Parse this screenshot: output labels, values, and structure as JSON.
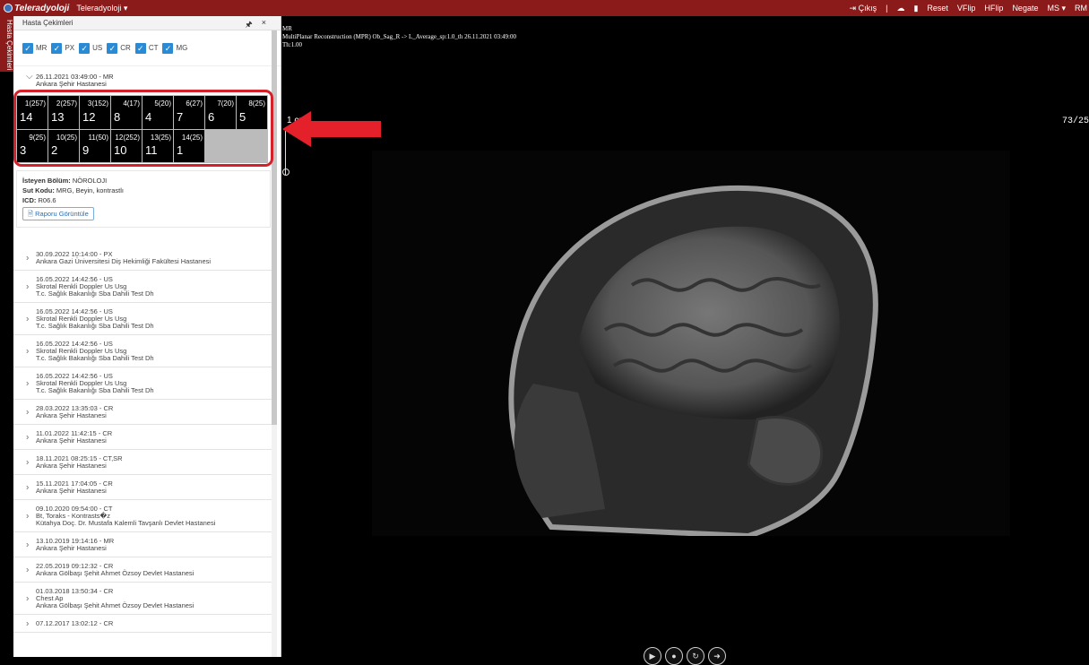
{
  "topbar": {
    "logo": "Teleradyoloji",
    "app_menu": "Teleradyoloji ▾",
    "logout": "Çıkış",
    "reset": "Reset",
    "vflip": "VFlip",
    "hflip": "HFlip",
    "negate": "Negate",
    "ms": "MS ▾",
    "rm": "RM"
  },
  "side_tab": "Hasta Çekimleri",
  "panel": {
    "title": "Hasta Çekimleri",
    "pin": "🖈",
    "close": "×",
    "filters": [
      "MR",
      "PX",
      "US",
      "CR",
      "CT",
      "MG"
    ]
  },
  "open_study": {
    "line1": "26.11.2021 03:49:00 - MR",
    "line2": "Ankara Şehir Hastanesi"
  },
  "series": [
    {
      "num": "14",
      "sup": "1(257)"
    },
    {
      "num": "13",
      "sup": "2(257)"
    },
    {
      "num": "12",
      "sup": "3(152)"
    },
    {
      "num": "8",
      "sup": "4(17)"
    },
    {
      "num": "4",
      "sup": "5(20)"
    },
    {
      "num": "7",
      "sup": "6(27)"
    },
    {
      "num": "6",
      "sup": "7(20)"
    },
    {
      "num": "5",
      "sup": "8(25)"
    },
    {
      "num": "3",
      "sup": "9(25)"
    },
    {
      "num": "2",
      "sup": "10(25)"
    },
    {
      "num": "9",
      "sup": "11(50)"
    },
    {
      "num": "10",
      "sup": "12(252)"
    },
    {
      "num": "11",
      "sup": "13(25)"
    },
    {
      "num": "1",
      "sup": "14(25)"
    }
  ],
  "info": {
    "bolum_label": "İsteyen Bölüm:",
    "bolum": "NÖROLOJI",
    "sut_label": "Sut Kodu:",
    "sut": "MRG, Beyin, kontrastlı",
    "icd_label": "ICD:",
    "icd": "R06.6",
    "report_button": "Raporu Görüntüle"
  },
  "studies": [
    {
      "lines": [
        "30.09.2022 10:14:00 - PX",
        "Ankara Gazi Üniversitesi Diş Hekimliği Fakültesi Hastanesi"
      ]
    },
    {
      "lines": [
        "16.05.2022 14:42:56 - US",
        "Skrotal Renkli Doppler Us Usg",
        "T.c. Sağlık Bakanlığı Sba Dahili Test Dh"
      ]
    },
    {
      "lines": [
        "16.05.2022 14:42:56 - US",
        "Skrotal Renkli Doppler Us Usg",
        "T.c. Sağlık Bakanlığı Sba Dahili Test Dh"
      ]
    },
    {
      "lines": [
        "16.05.2022 14:42:56 - US",
        "Skrotal Renkli Doppler Us Usg",
        "T.c. Sağlık Bakanlığı Sba Dahili Test Dh"
      ]
    },
    {
      "lines": [
        "16.05.2022 14:42:56 - US",
        "Skrotal Renkli Doppler Us Usg",
        "T.c. Sağlık Bakanlığı Sba Dahili Test Dh"
      ]
    },
    {
      "lines": [
        "28.03.2022 13:35:03 - CR",
        "Ankara Şehir Hastanesi"
      ]
    },
    {
      "lines": [
        "11.01.2022 11:42:15 - CR",
        "Ankara Şehir Hastanesi"
      ]
    },
    {
      "lines": [
        "18.11.2021 08:25:15 - CT,SR",
        "Ankara Şehir Hastanesi"
      ]
    },
    {
      "lines": [
        "15.11.2021 17:04:05 - CR",
        "Ankara Şehir Hastanesi"
      ]
    },
    {
      "lines": [
        "09.10.2020 09:54:00 - CT",
        "Bt, Toraks - Kontrasts�z",
        "Kütahya Doç. Dr. Mustafa Kalemli Tavşanlı Devlet Hastanesi"
      ]
    },
    {
      "lines": [
        "13.10.2019 19:14:16 - MR",
        "Ankara Şehir Hastanesi"
      ]
    },
    {
      "lines": [
        "22.05.2019 09:12:32 - CR",
        "Ankara Gölbaşı Şehit Ahmet Özsoy Devlet Hastanesi"
      ]
    },
    {
      "lines": [
        "01.03.2018 13:50:34 - CR",
        "Chest Ap",
        "Ankara Gölbaşı Şehit Ahmet Özsoy Devlet Hastanesi"
      ]
    },
    {
      "lines": [
        "07.12.2017 13:02:12 - CR"
      ]
    }
  ],
  "viewer": {
    "modality": "MR",
    "series_desc": "MultiPlanar Reconstruction (MPR) Ob_Sag_R -> L_Average_sp:1.0_th 26.11.2021 03:49:00",
    "thickness": "Th:1.00",
    "slice_counter": "73/25",
    "scale_label": "1 cm"
  }
}
